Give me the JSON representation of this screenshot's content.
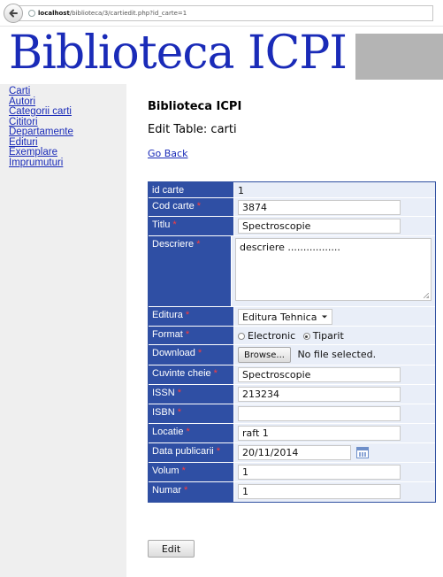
{
  "browser": {
    "url_host": "localhost",
    "url_path": "/biblioteca/3/cartiedit.php?id_carte=1"
  },
  "banner": {
    "title": "Biblioteca ICPI"
  },
  "sidebar": {
    "items": [
      {
        "label": "Carti"
      },
      {
        "label": "Autori"
      },
      {
        "label": "Categorii carti"
      },
      {
        "label": "Cititori"
      },
      {
        "label": "Departamente"
      },
      {
        "label": "Edituri"
      },
      {
        "label": "Exemplare"
      },
      {
        "label": "Imprumuturi"
      }
    ]
  },
  "main": {
    "heading": "Biblioteca ICPI",
    "subheading": "Edit Table: carti",
    "go_back": "Go Back",
    "required_marker": "*",
    "form": {
      "id_carte": {
        "label": "id carte",
        "value": "1"
      },
      "cod_carte": {
        "label": "Cod carte",
        "value": "3874"
      },
      "titlu": {
        "label": "Titlu",
        "value": "Spectroscopie"
      },
      "descriere": {
        "label": "Descriere",
        "value": "descriere ................."
      },
      "editura": {
        "label": "Editura",
        "value": "Editura Tehnica"
      },
      "format": {
        "label": "Format",
        "option_1": "Electronic",
        "option_2": "Tiparit",
        "selected": "Tiparit"
      },
      "download": {
        "label": "Download",
        "button": "Browse...",
        "status": "No file selected."
      },
      "cuvinte_cheie": {
        "label": "Cuvinte cheie",
        "value": "Spectroscopie"
      },
      "issn": {
        "label": "ISSN",
        "value": "213234"
      },
      "isbn": {
        "label": "ISBN",
        "value": ""
      },
      "locatie": {
        "label": "Locatie",
        "value": "raft 1"
      },
      "data_publicarii": {
        "label": "Data publicarii",
        "value": "20/11/2014"
      },
      "volum": {
        "label": "Volum",
        "value": "1"
      },
      "numar": {
        "label": "Numar",
        "value": "1"
      }
    },
    "edit_button": "Edit"
  }
}
